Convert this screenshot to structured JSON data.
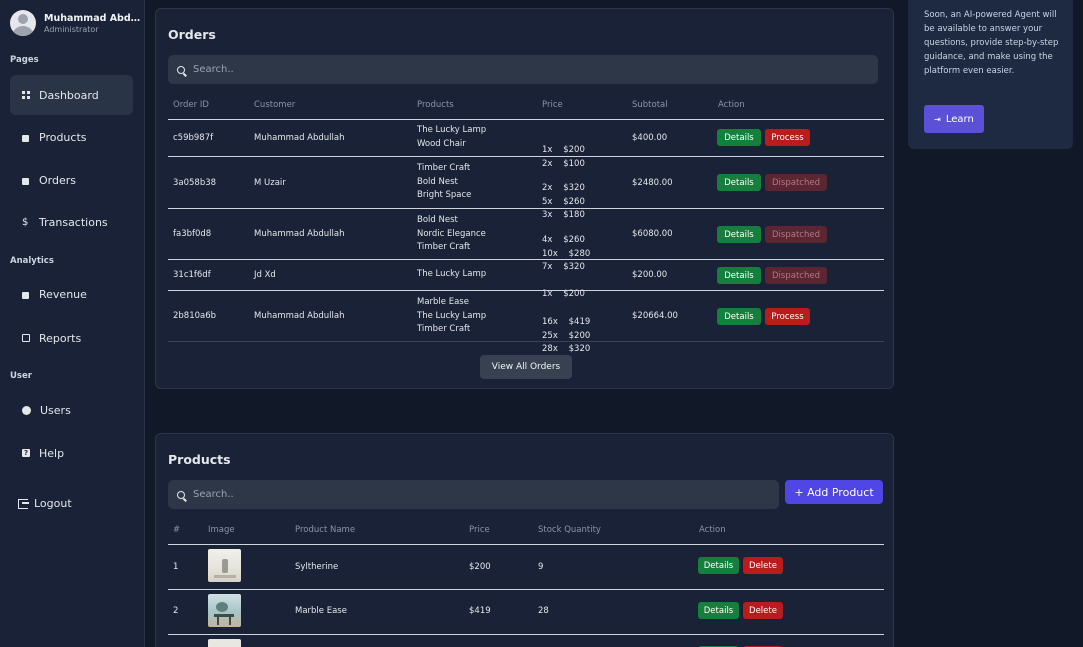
{
  "sidebar": {
    "user_name": "Muhammad Abdullah",
    "user_role": "Administrator",
    "sections": {
      "pages": "Pages",
      "analytics": "Analytics",
      "user": "User"
    },
    "items": {
      "dashboard": "Dashboard",
      "products": "Products",
      "orders": "Orders",
      "transactions": "Transactions",
      "revenue": "Revenue",
      "reports": "Reports",
      "users": "Users",
      "help": "Help"
    },
    "logout": "Logout"
  },
  "orders": {
    "title": "Orders",
    "search_placeholder": "Search..",
    "columns": [
      "Order ID",
      "Customer",
      "Products",
      "Price",
      "Subtotal",
      "Action"
    ],
    "rows": [
      {
        "id": "c59b987f",
        "customer": "Muhammad Abdullah",
        "products": [
          "The Lucky Lamp",
          "Wood Chair"
        ],
        "prices": [
          "1x    $200",
          "2x    $100"
        ],
        "subtotal": "$400.00",
        "details": "Details",
        "status": "Process"
      },
      {
        "id": "3a058b38",
        "customer": "M Uzair",
        "products": [
          "Timber Craft",
          "Bold Nest",
          "Bright Space"
        ],
        "prices": [
          "2x    $320",
          "5x    $260",
          "3x    $180"
        ],
        "subtotal": "$2480.00",
        "details": "Details",
        "status": "Dispatched"
      },
      {
        "id": "fa3bf0d8",
        "customer": "Muhammad Abdullah",
        "products": [
          "Bold Nest",
          "Nordic Elegance",
          "Timber Craft"
        ],
        "prices": [
          "4x    $260",
          "10x    $280",
          "7x    $320"
        ],
        "subtotal": "$6080.00",
        "details": "Details",
        "status": "Dispatched"
      },
      {
        "id": "31c1f6df",
        "customer": "Jd Xd",
        "products": [
          "The Lucky Lamp"
        ],
        "prices": [
          "1x    $200"
        ],
        "subtotal": "$200.00",
        "details": "Details",
        "status": "Dispatched"
      },
      {
        "id": "2b810a6b",
        "customer": "Muhammad Abdullah",
        "products": [
          "Marble Ease",
          "The Lucky Lamp",
          "Timber Craft"
        ],
        "prices": [
          "16x    $419",
          "25x    $200",
          "28x    $320"
        ],
        "subtotal": "$20664.00",
        "details": "Details",
        "status": "Process"
      }
    ],
    "view_all": "View All Orders"
  },
  "products": {
    "title": "Products",
    "search_placeholder": "Search..",
    "add_button": "+ Add Product",
    "columns": [
      "#",
      "Image",
      "Product Name",
      "Price",
      "Stock Quantity",
      "Action"
    ],
    "rows": [
      {
        "num": "1",
        "name": "Syltherine",
        "price": "$200",
        "stock": "9",
        "details": "Details",
        "delete": "Delete"
      },
      {
        "num": "2",
        "name": "Marble Ease",
        "price": "$419",
        "stock": "28",
        "details": "Details",
        "delete": "Delete"
      }
    ]
  },
  "ai_panel": {
    "text": "Soon, an AI-powered Agent will be available to answer your questions, provide step-by-step guidance, and make using the platform even easier.",
    "learn": "Learn"
  },
  "colors": {
    "background": "#111827",
    "card": "#192236",
    "accent": "#4f46e5",
    "success": "#15803d",
    "danger": "#b91c1c"
  }
}
